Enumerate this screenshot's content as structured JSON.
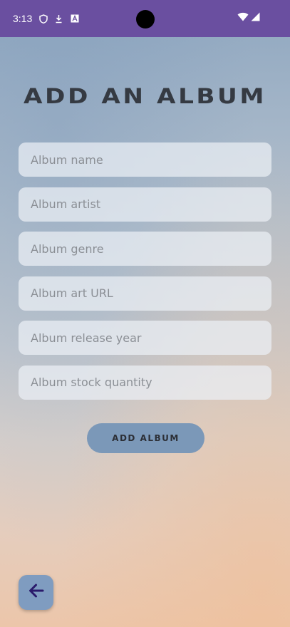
{
  "status_bar": {
    "time": "3:13",
    "icons": [
      "shield-icon",
      "download-icon",
      "font-a-icon",
      "wifi-icon",
      "signal-icon"
    ]
  },
  "page": {
    "title": "ADD AN ALBUM"
  },
  "form": {
    "fields": [
      {
        "placeholder": "Album name",
        "value": ""
      },
      {
        "placeholder": "Album artist",
        "value": ""
      },
      {
        "placeholder": "Album genre",
        "value": ""
      },
      {
        "placeholder": "Album art URL",
        "value": ""
      },
      {
        "placeholder": "Album release year",
        "value": ""
      },
      {
        "placeholder": "Album stock quantity",
        "value": ""
      }
    ],
    "submit_label": "ADD ALBUM"
  },
  "back_button": {
    "icon": "arrow-left-icon"
  },
  "colors": {
    "status_bar": "#6a4fa0",
    "button": "#7b98b8",
    "back_button": "#7f9cc0",
    "arrow": "#2a1a6b"
  }
}
